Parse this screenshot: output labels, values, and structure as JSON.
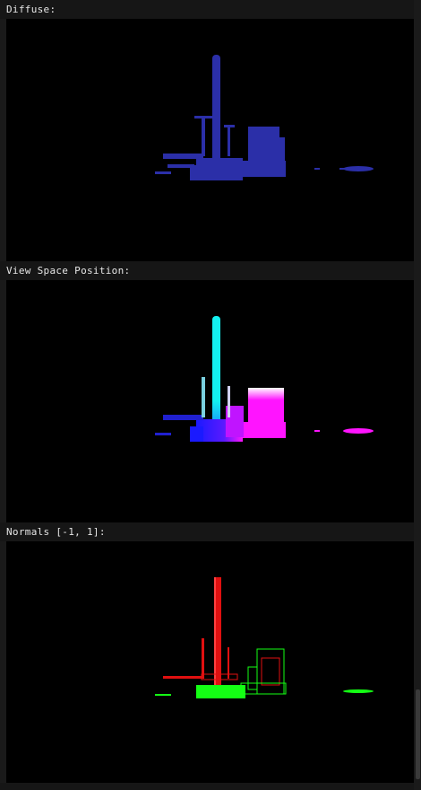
{
  "panels": [
    {
      "id": "diffuse",
      "label": "Diffuse:"
    },
    {
      "id": "position",
      "label": "View Space Position:"
    },
    {
      "id": "normals",
      "label": "Normals [-1, 1]:"
    }
  ],
  "colors": {
    "diffuse": "#2b2fa8",
    "position_cyan": "#13f0f0",
    "position_magenta": "#ff14ff",
    "position_blue": "#1a1aff",
    "normals_red": "#e01010",
    "normals_green": "#14ff14"
  }
}
